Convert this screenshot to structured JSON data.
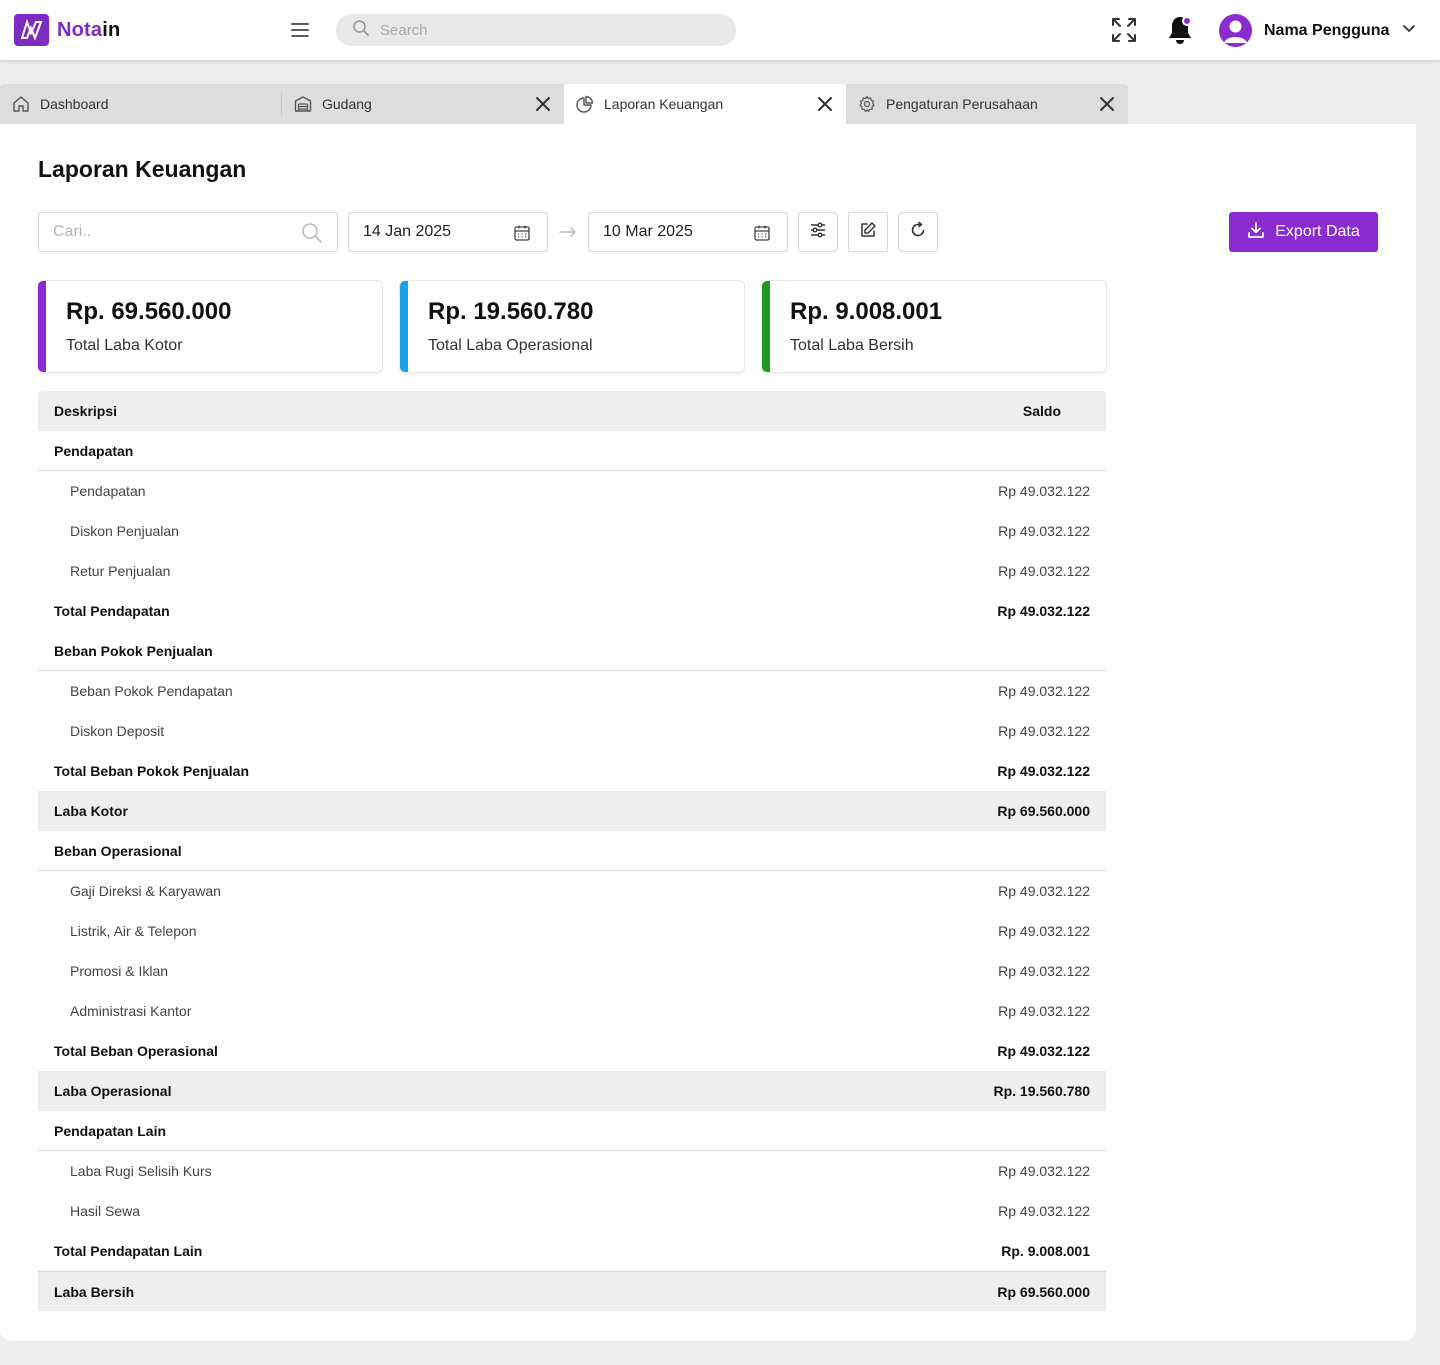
{
  "brand": {
    "name_part1": "Nota",
    "name_part2": "in",
    "accent": "#8a2cd0"
  },
  "header": {
    "search_placeholder": "Search",
    "user_name": "Nama Pengguna"
  },
  "tabs": [
    {
      "label": "Dashboard",
      "icon": "home-icon",
      "closable": false
    },
    {
      "label": "Gudang",
      "icon": "warehouse-icon",
      "closable": true
    },
    {
      "label": "Laporan Keuangan",
      "icon": "pie-chart-icon",
      "closable": true,
      "active": true
    },
    {
      "label": "Pengaturan Perusahaan",
      "icon": "gear-icon",
      "closable": true
    }
  ],
  "page": {
    "title": "Laporan Keuangan",
    "search_placeholder": "Cari..",
    "date_from": "14 Jan 2025",
    "date_to": "10 Mar 2025",
    "export_label": "Export Data"
  },
  "cards": [
    {
      "amount": "Rp. 69.560.000",
      "label": "Total Laba Kotor",
      "color": "#8a2cd0"
    },
    {
      "amount": "Rp. 19.560.780",
      "label": "Total Laba Operasional",
      "color": "#1aa3e0"
    },
    {
      "amount": "Rp. 9.008.001",
      "label": "Total Laba Bersih",
      "color": "#1e9a1e"
    }
  ],
  "table": {
    "col_desc": "Deskripsi",
    "col_saldo": "Saldo",
    "rows": [
      {
        "type": "section",
        "desc": "Pendapatan",
        "saldo": ""
      },
      {
        "type": "item",
        "desc": "Pendapatan",
        "saldo": "Rp 49.032.122"
      },
      {
        "type": "item",
        "desc": "Diskon Penjualan",
        "saldo": "Rp 49.032.122"
      },
      {
        "type": "item",
        "desc": "Retur Penjualan",
        "saldo": "Rp 49.032.122"
      },
      {
        "type": "total",
        "desc": "Total Pendapatan",
        "saldo": "Rp 49.032.122"
      },
      {
        "type": "section",
        "desc": "Beban Pokok Penjualan",
        "saldo": ""
      },
      {
        "type": "item",
        "desc": "Beban Pokok Pendapatan",
        "saldo": "Rp 49.032.122"
      },
      {
        "type": "item",
        "desc": "Diskon Deposit",
        "saldo": "Rp 49.032.122"
      },
      {
        "type": "total",
        "desc": "Total Beban Pokok Penjualan",
        "saldo": "Rp 49.032.122"
      },
      {
        "type": "summary",
        "desc": "Laba Kotor",
        "saldo": "Rp 69.560.000"
      },
      {
        "type": "section",
        "desc": "Beban Operasional",
        "saldo": ""
      },
      {
        "type": "item",
        "desc": "Gaji Direksi & Karyawan",
        "saldo": "Rp 49.032.122"
      },
      {
        "type": "item",
        "desc": "Listrik, Air & Telepon",
        "saldo": "Rp 49.032.122"
      },
      {
        "type": "item",
        "desc": "Promosi & Iklan",
        "saldo": "Rp 49.032.122"
      },
      {
        "type": "item",
        "desc": "Administrasi Kantor",
        "saldo": "Rp 49.032.122"
      },
      {
        "type": "total",
        "desc": "Total Beban Operasional",
        "saldo": "Rp 49.032.122"
      },
      {
        "type": "summary",
        "desc": "Laba Operasional",
        "saldo": "Rp. 19.560.780"
      },
      {
        "type": "section",
        "desc": "Pendapatan Lain",
        "saldo": ""
      },
      {
        "type": "item",
        "desc": "Laba Rugi Selisih Kurs",
        "saldo": "Rp 49.032.122"
      },
      {
        "type": "item",
        "desc": "Hasil Sewa",
        "saldo": "Rp 49.032.122"
      },
      {
        "type": "total",
        "desc": "Total Pendapatan Lain",
        "saldo": "Rp. 9.008.001"
      },
      {
        "type": "summary",
        "desc": "Laba Bersih",
        "saldo": "Rp 69.560.000",
        "border_top": true
      }
    ]
  }
}
